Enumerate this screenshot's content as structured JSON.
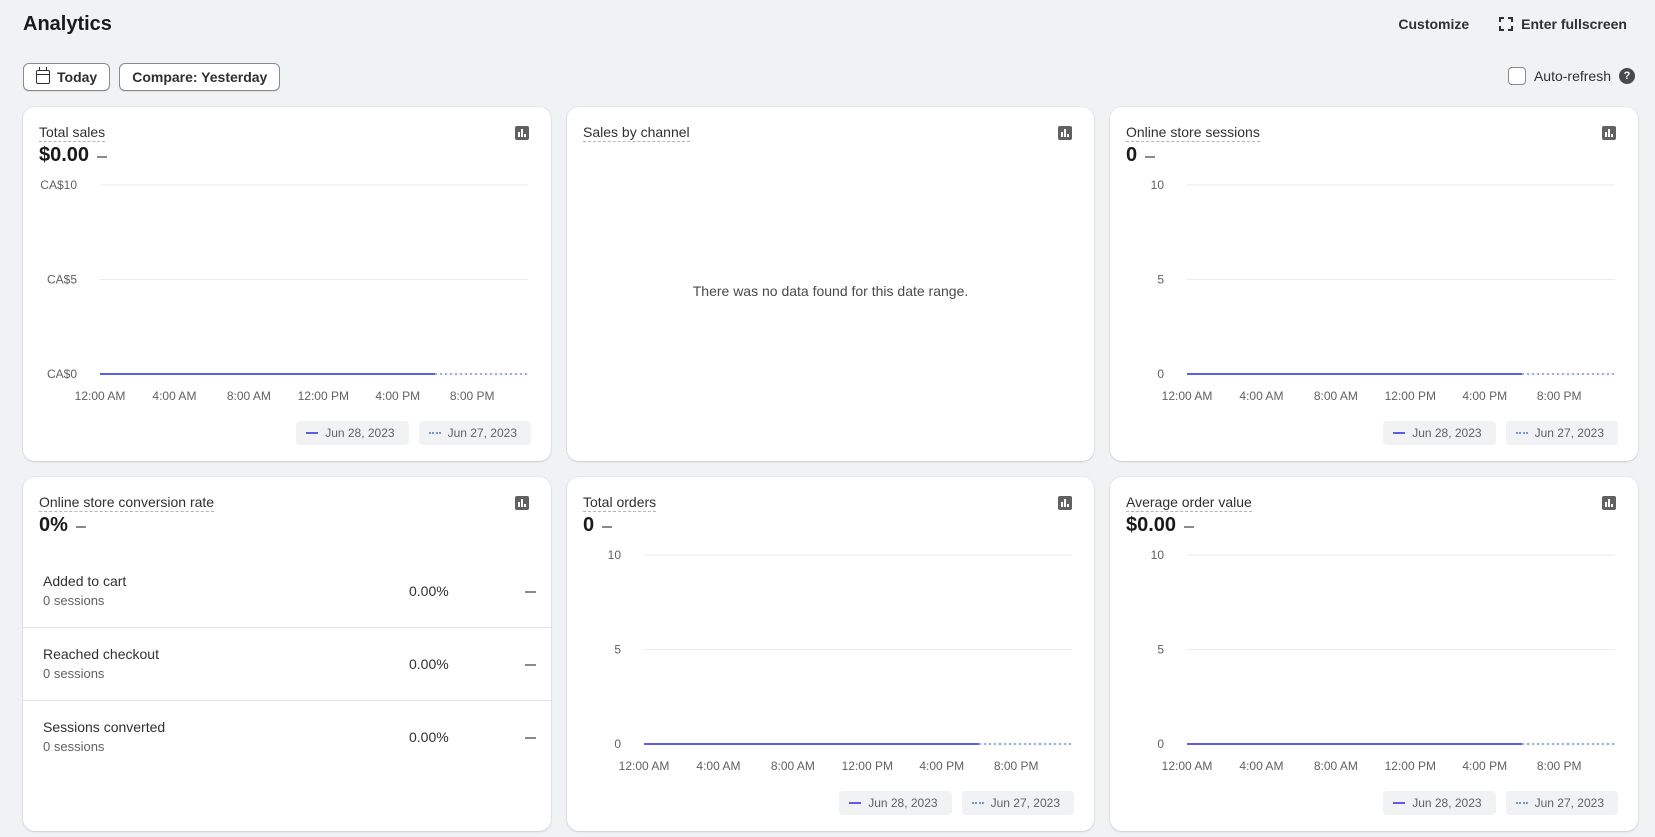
{
  "page": {
    "title": "Analytics"
  },
  "header_actions": {
    "customize": "Customize",
    "fullscreen": "Enter fullscreen"
  },
  "toolbar": {
    "date_range": "Today",
    "compare": "Compare: Yesterday"
  },
  "auto_refresh": {
    "label": "Auto-refresh",
    "checked": false,
    "help": "?"
  },
  "legend": {
    "current": "Jun 28, 2023",
    "previous": "Jun 27, 2023"
  },
  "colors": {
    "current_series": "#5c5fe6",
    "previous_series": "#7b93d6",
    "grid": "#ebebeb"
  },
  "cards": {
    "total_sales": {
      "title": "Total sales",
      "value": "$0.00"
    },
    "sales_by_channel": {
      "title": "Sales by channel",
      "empty_message": "There was no data found for this date range."
    },
    "sessions": {
      "title": "Online store sessions",
      "value": "0"
    },
    "conversion": {
      "title": "Online store conversion rate",
      "value": "0%",
      "rows": [
        {
          "label": "Added to cart",
          "sessions": "0 sessions",
          "pct": "0.00%"
        },
        {
          "label": "Reached checkout",
          "sessions": "0 sessions",
          "pct": "0.00%"
        },
        {
          "label": "Sessions converted",
          "sessions": "0 sessions",
          "pct": "0.00%"
        }
      ]
    },
    "orders": {
      "title": "Total orders",
      "value": "0"
    },
    "aov": {
      "title": "Average order value",
      "value": "$0.00"
    }
  },
  "chart_data": [
    {
      "type": "line",
      "title": "Total sales",
      "categories": [
        "12:00 AM",
        "4:00 AM",
        "8:00 AM",
        "12:00 PM",
        "4:00 PM",
        "8:00 PM"
      ],
      "ytick_labels": [
        "CA$10",
        "CA$5",
        "CA$0"
      ],
      "ylim": [
        0,
        10
      ],
      "series": [
        {
          "name": "Jun 28, 2023",
          "style": "solid",
          "x_range": [
            0,
            18
          ],
          "values": [
            0,
            0
          ]
        },
        {
          "name": "Jun 27, 2023",
          "style": "dotted",
          "x_range": [
            0,
            23
          ],
          "values": [
            0,
            0
          ]
        }
      ],
      "grid": true,
      "legend": "bottom-right"
    },
    {
      "type": "line",
      "title": "Online store sessions",
      "categories": [
        "12:00 AM",
        "4:00 AM",
        "8:00 AM",
        "12:00 PM",
        "4:00 PM",
        "8:00 PM"
      ],
      "ytick_labels": [
        "10",
        "5",
        "0"
      ],
      "ylim": [
        0,
        10
      ],
      "series": [
        {
          "name": "Jun 28, 2023",
          "style": "solid",
          "x_range": [
            0,
            18
          ],
          "values": [
            0,
            0
          ]
        },
        {
          "name": "Jun 27, 2023",
          "style": "dotted",
          "x_range": [
            0,
            23
          ],
          "values": [
            0,
            0
          ]
        }
      ],
      "grid": true,
      "legend": "bottom-right"
    },
    {
      "type": "line",
      "title": "Total orders",
      "categories": [
        "12:00 AM",
        "4:00 AM",
        "8:00 AM",
        "12:00 PM",
        "4:00 PM",
        "8:00 PM"
      ],
      "ytick_labels": [
        "10",
        "5",
        "0"
      ],
      "ylim": [
        0,
        10
      ],
      "series": [
        {
          "name": "Jun 28, 2023",
          "style": "solid",
          "x_range": [
            0,
            18
          ],
          "values": [
            0,
            0
          ]
        },
        {
          "name": "Jun 27, 2023",
          "style": "dotted",
          "x_range": [
            0,
            23
          ],
          "values": [
            0,
            0
          ]
        }
      ],
      "grid": true,
      "legend": "bottom-right"
    },
    {
      "type": "line",
      "title": "Average order value",
      "categories": [
        "12:00 AM",
        "4:00 AM",
        "8:00 AM",
        "12:00 PM",
        "4:00 PM",
        "8:00 PM"
      ],
      "ytick_labels": [
        "10",
        "5",
        "0"
      ],
      "ylim": [
        0,
        10
      ],
      "series": [
        {
          "name": "Jun 28, 2023",
          "style": "solid",
          "x_range": [
            0,
            18
          ],
          "values": [
            0,
            0
          ]
        },
        {
          "name": "Jun 27, 2023",
          "style": "dotted",
          "x_range": [
            0,
            23
          ],
          "values": [
            0,
            0
          ]
        }
      ],
      "grid": true,
      "legend": "bottom-right"
    }
  ]
}
